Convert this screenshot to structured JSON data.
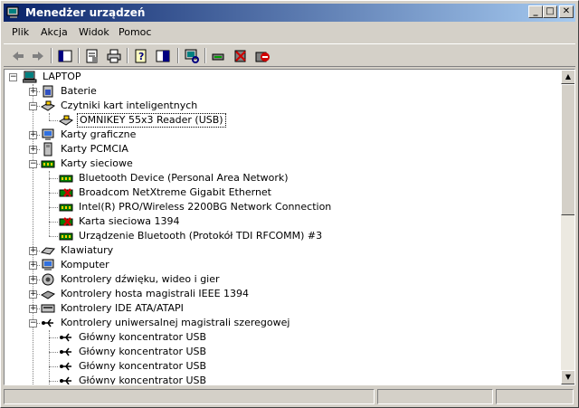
{
  "window": {
    "title": "Menedżer urządzeń"
  },
  "menu": [
    "Plik",
    "Akcja",
    "Widok",
    "Pomoc"
  ],
  "toolbar": [
    "back-icon",
    "forward-icon",
    "show-hide-tree-icon",
    "properties-icon",
    "print-icon",
    "help-icon",
    "view-icon",
    "scan-hardware-icon",
    "update-driver-icon",
    "uninstall-icon",
    "disable-icon"
  ],
  "tree": {
    "root": "LAPTOP",
    "items": [
      "Baterie",
      "Czytniki kart inteligentnych",
      "OMNIKEY 55x3 Reader (USB)",
      "Karty graficzne",
      "Karty PCMCIA",
      "Karty sieciowe",
      "Bluetooth Device (Personal Area Network)",
      "Broadcom NetXtreme Gigabit Ethernet",
      "Intel(R) PRO/Wireless 2200BG Network Connection",
      "Karta sieciowa 1394",
      "Urządzenie Bluetooth (Protokół TDI RFCOMM) #3",
      "Klawiatury",
      "Komputer",
      "Kontrolery dźwięku, wideo i gier",
      "Kontrolery hosta magistrali IEEE 1394",
      "Kontrolery IDE ATA/ATAPI",
      "Kontrolery uniwersalnej magistrali szeregowej",
      "Główny koncentrator USB",
      "Główny koncentrator USB",
      "Główny koncentrator USB",
      "Główny koncentrator USB"
    ]
  },
  "colors": {
    "title_start": "#0a246a",
    "title_end": "#a6caf0",
    "chrome": "#d4d0c8"
  }
}
